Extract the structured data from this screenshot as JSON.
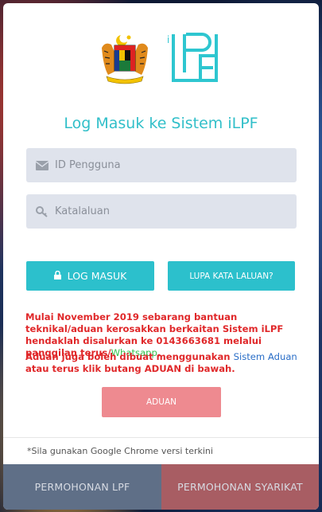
{
  "title": "Log Masuk ke Sistem iLPF",
  "logo": {
    "text": "iLPF"
  },
  "fields": {
    "username_placeholder": "ID Pengguna",
    "password_placeholder": "Katalaluan"
  },
  "buttons": {
    "login": "LOG MASUK",
    "forgot": "LUPA KATA LALUAN?",
    "aduan": "ADUAN"
  },
  "notice": {
    "p1_text": "Mulai November 2019 sebarang bantuan teknikal/aduan kerosakkan berkaitan Sistem iLPF hendaklah disalurkan ke 0143663681 melalui panggilan terus/",
    "p1_link": "Whatsapp",
    "p1_end": ".",
    "p2_start": "Aduan juga boleh dibuat menggunakan ",
    "p2_link": "Sistem Aduan",
    "p2_end": " atau terus klik butang ADUAN di bawah."
  },
  "footnote": "*Sila gunakan Google Chrome versi terkini",
  "tabs": {
    "lpf": "PERMOHONAN LPF",
    "syarikat": "PERMOHONAN SYARIKAT"
  },
  "colors": {
    "accent": "#2cc0cc",
    "danger": "#e0282a",
    "aduan": "#ee8a90",
    "tab_lpf": "#5f6f87",
    "tab_syarikat": "#a85d63"
  }
}
